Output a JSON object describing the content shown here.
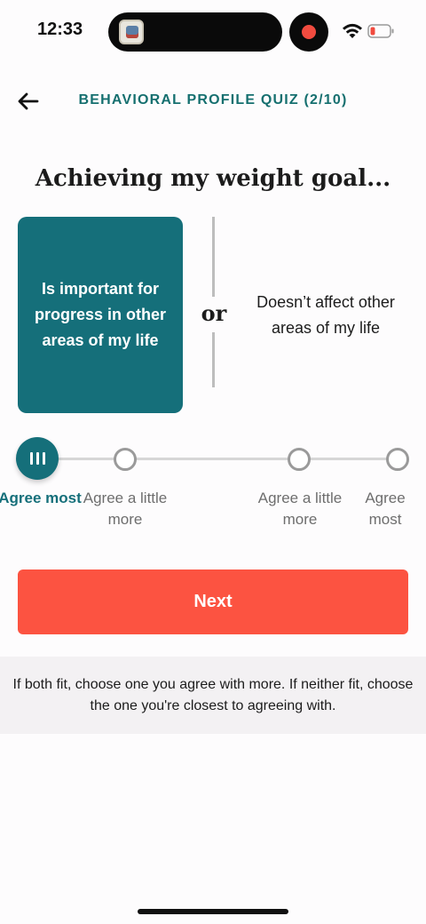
{
  "status_bar": {
    "time": "12:33"
  },
  "header": {
    "title": "BEHAVIORAL PROFILE QUIZ (2/10)"
  },
  "question": {
    "title": "Achieving my weight goal...",
    "option_left": "Is important for progress in other areas of my life",
    "separator": "or",
    "option_right": "Doesn’t affect other areas of my life"
  },
  "scale": {
    "selected_index": 0,
    "labels": [
      "Agree most",
      "Agree a little more",
      "Agree a little more",
      "Agree most"
    ]
  },
  "next_button": {
    "label": "Next"
  },
  "helper_text": "If both fit, choose one you agree with more. If neither fit, choose the one you're closest to agreeing with.",
  "colors": {
    "accent": "#156f7a",
    "primary_button": "#fc5341",
    "helper_bg": "#f3f1f3"
  }
}
